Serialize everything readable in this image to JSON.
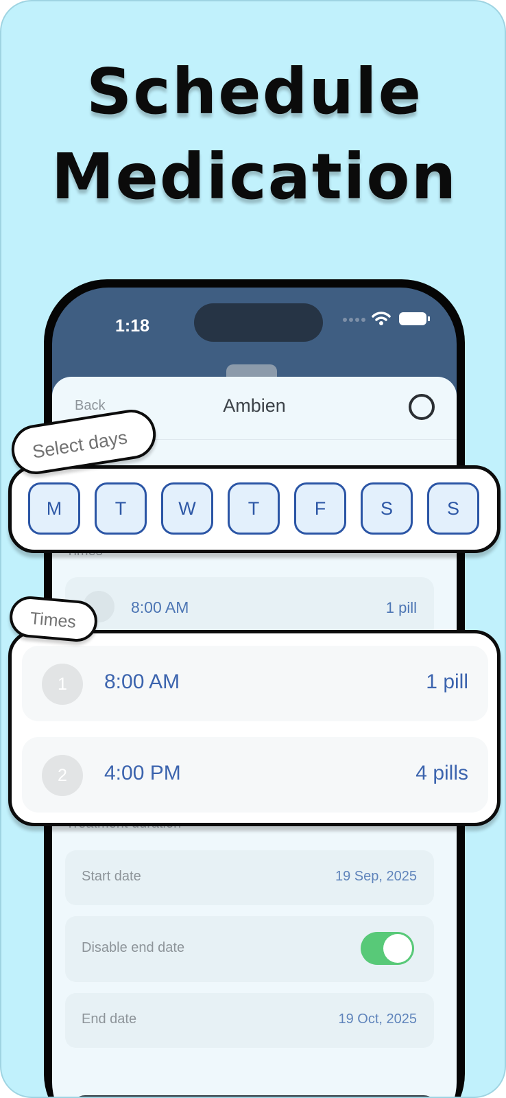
{
  "headline": {
    "line1": "Schedule",
    "line2": "Medication"
  },
  "status_bar": {
    "time": "1:18"
  },
  "sheet": {
    "back_label": "Back",
    "title": "Ambien"
  },
  "schedule": {
    "select_days_label": "Select days",
    "days": [
      "M",
      "T",
      "W",
      "T",
      "F",
      "S",
      "S"
    ],
    "times_label": "Times",
    "times": [
      {
        "index": "1",
        "time": "8:00 AM",
        "quantity": "1 pill"
      },
      {
        "index": "2",
        "time": "4:00 PM",
        "quantity": "4 pills"
      }
    ]
  },
  "background_times": {
    "label": "Times",
    "first": {
      "index": "1",
      "time": "8:00 AM",
      "quantity": "1 pill"
    }
  },
  "treatment": {
    "label": "Treatment duration",
    "start_date_label": "Start date",
    "start_date_value": "19 Sep, 2025",
    "disable_end_date_label": "Disable end date",
    "disable_end_date_on": true,
    "end_date_label": "End date",
    "end_date_value": "19 Oct, 2025"
  },
  "colors": {
    "background": "#c1f1fc",
    "header": "#3f5e82",
    "accent_blue": "#2e58a6",
    "toggle_on": "#58c978"
  }
}
